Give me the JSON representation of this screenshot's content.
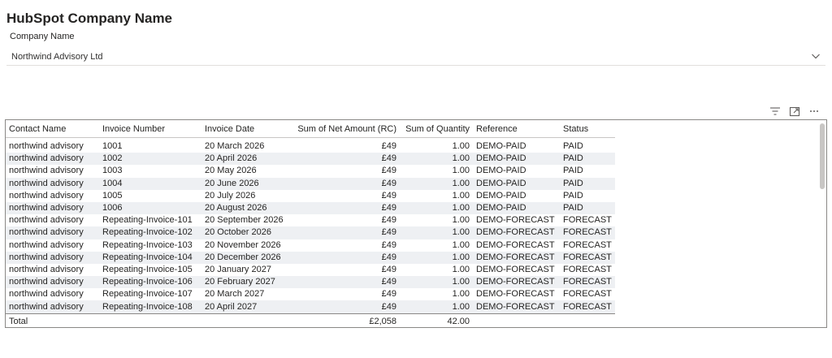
{
  "header": {
    "title": "HubSpot Company Name"
  },
  "slicer": {
    "label": "Company Name",
    "selected": "Northwind Advisory Ltd"
  },
  "icons": {
    "filter": "filter-icon",
    "focus": "focus-mode-icon",
    "more": "more-options-icon",
    "chevron": "chevron-down-icon"
  },
  "table": {
    "columns": [
      "Contact Name",
      "Invoice Number",
      "Invoice Date",
      "Sum of Net Amount (RC)",
      "Sum of Quantity",
      "Reference",
      "Status"
    ],
    "rows": [
      [
        "northwind advisory",
        "1001",
        "20 March 2026",
        "£49",
        "1.00",
        "DEMO-PAID",
        "PAID"
      ],
      [
        "northwind advisory",
        "1002",
        "20 April 2026",
        "£49",
        "1.00",
        "DEMO-PAID",
        "PAID"
      ],
      [
        "northwind advisory",
        "1003",
        "20 May 2026",
        "£49",
        "1.00",
        "DEMO-PAID",
        "PAID"
      ],
      [
        "northwind advisory",
        "1004",
        "20 June 2026",
        "£49",
        "1.00",
        "DEMO-PAID",
        "PAID"
      ],
      [
        "northwind advisory",
        "1005",
        "20 July 2026",
        "£49",
        "1.00",
        "DEMO-PAID",
        "PAID"
      ],
      [
        "northwind advisory",
        "1006",
        "20 August 2026",
        "£49",
        "1.00",
        "DEMO-PAID",
        "PAID"
      ],
      [
        "northwind advisory",
        "Repeating-Invoice-101",
        "20 September 2026",
        "£49",
        "1.00",
        "DEMO-FORECAST",
        "FORECAST"
      ],
      [
        "northwind advisory",
        "Repeating-Invoice-102",
        "20 October 2026",
        "£49",
        "1.00",
        "DEMO-FORECAST",
        "FORECAST"
      ],
      [
        "northwind advisory",
        "Repeating-Invoice-103",
        "20 November 2026",
        "£49",
        "1.00",
        "DEMO-FORECAST",
        "FORECAST"
      ],
      [
        "northwind advisory",
        "Repeating-Invoice-104",
        "20 December 2026",
        "£49",
        "1.00",
        "DEMO-FORECAST",
        "FORECAST"
      ],
      [
        "northwind advisory",
        "Repeating-Invoice-105",
        "20 January 2027",
        "£49",
        "1.00",
        "DEMO-FORECAST",
        "FORECAST"
      ],
      [
        "northwind advisory",
        "Repeating-Invoice-106",
        "20 February 2027",
        "£49",
        "1.00",
        "DEMO-FORECAST",
        "FORECAST"
      ],
      [
        "northwind advisory",
        "Repeating-Invoice-107",
        "20 March 2027",
        "£49",
        "1.00",
        "DEMO-FORECAST",
        "FORECAST"
      ],
      [
        "northwind advisory",
        "Repeating-Invoice-108",
        "20 April 2027",
        "£49",
        "1.00",
        "DEMO-FORECAST",
        "FORECAST"
      ]
    ],
    "total": {
      "label": "Total",
      "net_amount": "£2,058",
      "quantity": "42.00"
    }
  },
  "colors": {
    "row_alt": "#eef0f3",
    "border": "#8a8886",
    "text": "#252423"
  }
}
